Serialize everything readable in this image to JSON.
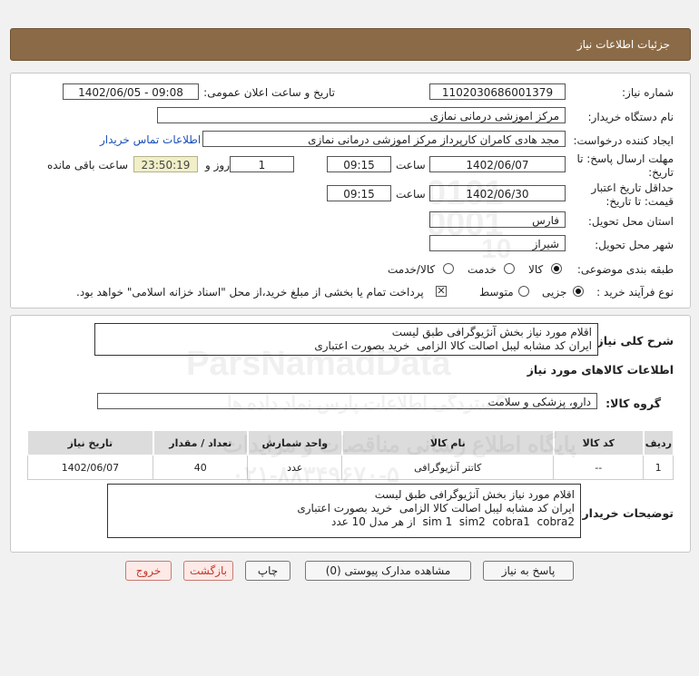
{
  "header": {
    "title": "جزئیات اطلاعات نیاز"
  },
  "form": {
    "need_number_label": "شماره نیاز:",
    "need_number": "1102030686001379",
    "announce_label": "تاریخ و ساعت اعلان عمومی:",
    "announce_value": "1402/06/05 - 09:08",
    "buyer_label": "نام دستگاه خریدار:",
    "buyer_value": "مرکز اموزشی درمانی نمازی",
    "creator_label": "ایجاد کننده درخواست:",
    "creator_value": "مجد هادی کامران کارپرداز مرکز اموزشی درمانی نمازی",
    "contact_link": "اطلاعات تماس خریدار",
    "deadline_label_1": "مهلت ارسال پاسخ: تا",
    "deadline_label_2": "تاریخ:",
    "deadline_date": "1402/06/07",
    "time_label": "ساعت",
    "deadline_time": "09:15",
    "days_value": "1",
    "days_label": "روز و",
    "remaining_time": "23:50:19",
    "remaining_label": "ساعت باقی مانده",
    "validity_label_1": "حداقل تاریخ اعتبار",
    "validity_label_2": "قیمت: تا تاریخ:",
    "validity_date": "1402/06/30",
    "validity_time_label": "ساعت",
    "validity_time": "09:15",
    "province_label": "استان محل تحویل:",
    "province_value": "فارس",
    "city_label": "شهر محل تحویل:",
    "city_value": "شیراز",
    "category_label": "طبقه بندی موضوعی:",
    "category_options": [
      "کالا",
      "خدمت",
      "کالا/خدمت"
    ],
    "category_selected": "کالا",
    "process_label": "نوع فرآیند خرید :",
    "process_options": [
      "جزیی",
      "متوسط"
    ],
    "process_selected": "جزیی",
    "payment_note": "پرداخت تمام یا بخشی از مبلغ خرید،از محل \"اسناد خزانه اسلامی\" خواهد بود."
  },
  "summary": {
    "label": "شرح کلی نیاز:",
    "lines": [
      "اقلام مورد نیاز بخش آنژیوگرافی طبق لیست",
      "ایران کد مشابه لیبل اصالت کالا الزامی  خرید بصورت اعتباری"
    ],
    "items_title": "اطلاعات کالاهای مورد نیاز",
    "group_label": "گروه کالا:",
    "group_value": "دارو، پزشکی و سلامت"
  },
  "table": {
    "headers": [
      "ردیف",
      "کد کالا",
      "نام کالا",
      "واحد شمارش",
      "تعداد / مقدار",
      "تاریخ نیاز"
    ],
    "rows": [
      [
        "1",
        "--",
        "کاتتر آنژیوگرافی",
        "عدد",
        "40",
        "1402/06/07"
      ]
    ]
  },
  "buyer_notes": {
    "label": "توضیحات خریدار:",
    "lines": [
      "اقلام مورد نیاز بخش آنژیوگرافی طبق لیست",
      "ایران کد مشابه لیبل اصالت کالا الزامی  خرید بصورت اعتباری",
      "sim 1  sim2  cobra1  cobra2  از هر مدل 10 عدد"
    ]
  },
  "buttons": {
    "reply": "پاسخ به نیاز",
    "attachments": "مشاهده مدارک پیوستی (0)",
    "print": "چاپ",
    "back": "بازگشت",
    "exit": "خروج"
  },
  "watermark": {
    "brand": "ParsNamadData",
    "line1": "پایگاه اطلاع رسانی مناقصات و مزایدات",
    "line2": "گستردگی اطلاعات پارس نماد داده ها",
    "phone": "۰۲۱-۸۸۳۴۹۶۷۰-۵",
    "num1": "0101",
    "num2": "0001",
    "num3": "10"
  }
}
